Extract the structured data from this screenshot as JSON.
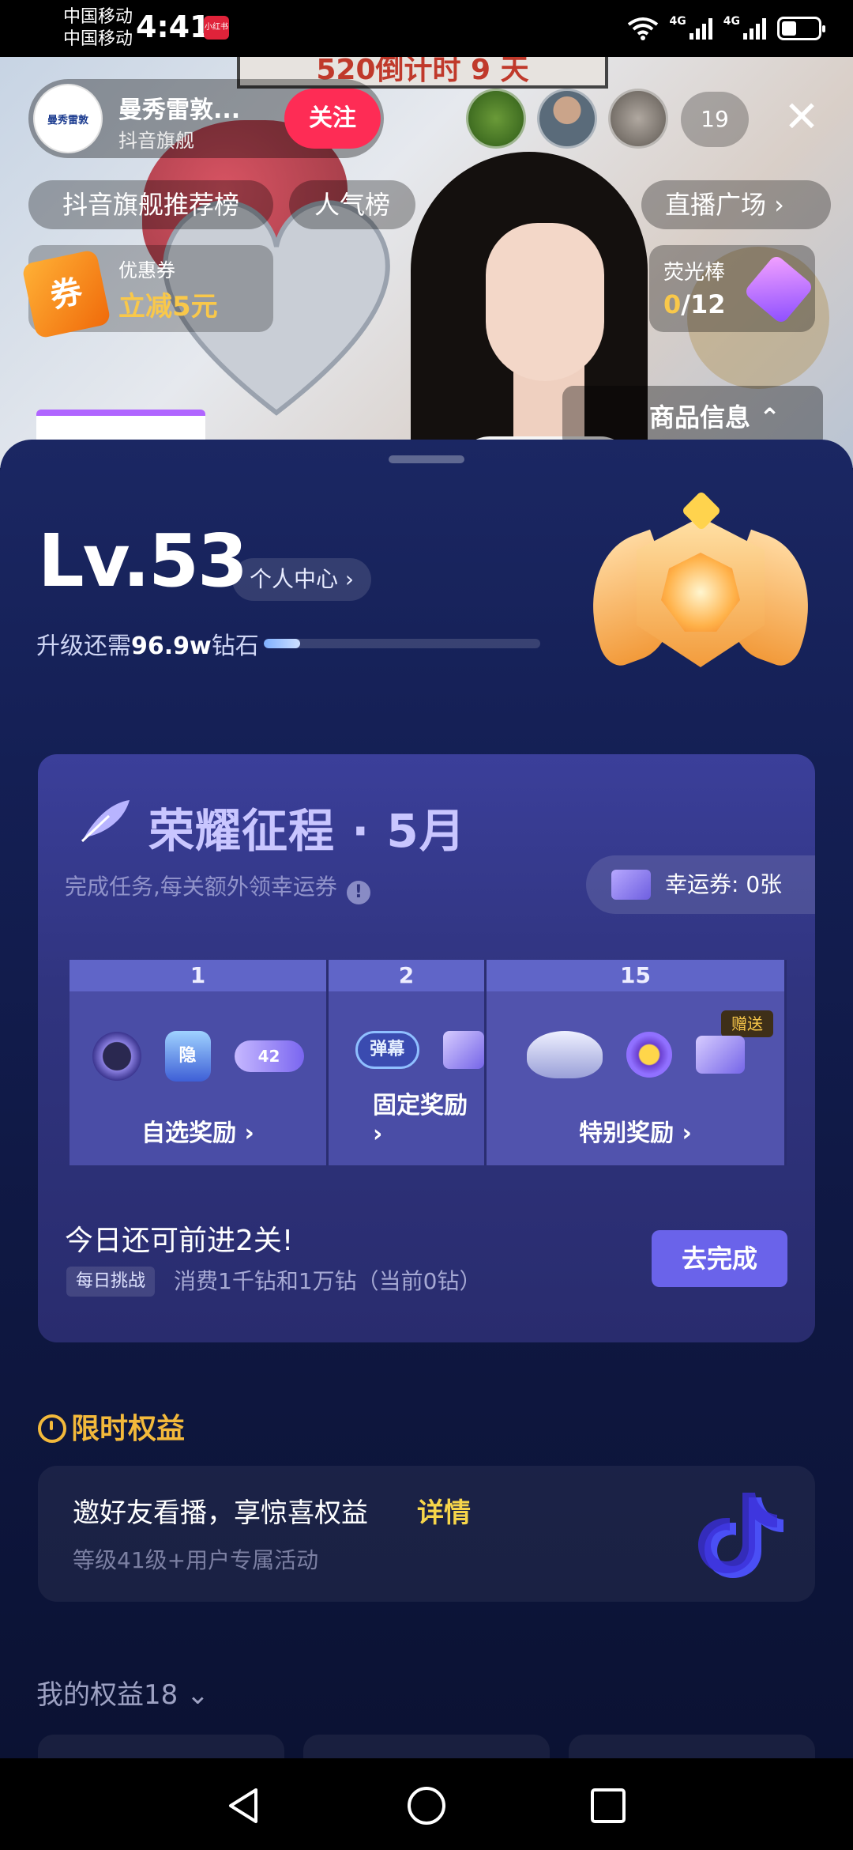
{
  "status_bar": {
    "carrier_1": "中国移动",
    "carrier_2": "中国移动",
    "time": "4:41",
    "app_badge": "小红书",
    "network_1": "4G",
    "network_2": "4G"
  },
  "live": {
    "banner_text": "520倒计时 9 天",
    "anchor_name": "曼秀雷敦...",
    "anchor_subtitle": "抖音旗舰",
    "anchor_avatar_text": "曼秀雷敦",
    "follow_label": "关注",
    "viewer_count": "19",
    "close_icon": "close-icon",
    "pills": {
      "recommend": "抖音旗舰推荐榜",
      "popularity": "人气榜",
      "plaza": "直播广场 ›"
    },
    "coupon": {
      "icon_text": "券",
      "label": "优惠券",
      "value": "立减5元"
    },
    "glowstick": {
      "label": "荧光棒",
      "current": "0",
      "total": "/12"
    },
    "product_info": "商品信息 ⌃"
  },
  "sheet": {
    "level": "Lv.53",
    "profile_link": "个人中心 ›",
    "upgrade_prefix": "升级还需",
    "upgrade_amount": "96.9w",
    "upgrade_suffix": "钻石",
    "progress_fraction": 0.13,
    "quest": {
      "title": "荣耀征程 · 5月",
      "subtitle": "完成任务,每关额外领幸运券",
      "info_icon": "!",
      "lucky_label": "幸运券:",
      "lucky_value": "0张",
      "stages": [
        {
          "num": "1",
          "label": "自选奖励 ›",
          "chip": "42"
        },
        {
          "num": "2",
          "label": "固定奖励 ›",
          "chip": "弹幕"
        },
        {
          "num": "15",
          "label": "特别奖励 ›",
          "gift_tag": "赠送"
        }
      ],
      "shield_text": "隐",
      "today_text": "今日还可前进2关!",
      "daily_tag": "每日挑战",
      "daily_desc": "消费1千钻和1万钻（当前0钻）",
      "go_button": "去完成"
    },
    "limited": {
      "title": "限时权益",
      "invite_title": "邀好友看播，享惊喜权益",
      "invite_detail": "详情",
      "invite_sub": "等级41级+用户专属活动"
    },
    "my_rights": "我的权益18",
    "my_rights_icon": "chevron-down-icon"
  },
  "nav": {
    "back_icon": "back-triangle-icon",
    "home_icon": "home-circle-icon",
    "recents_icon": "recents-square-icon"
  },
  "colors": {
    "accent_red": "#fe2c55",
    "gold": "#f9c84a",
    "sheet_bg": "#141f54",
    "button_purple": "#6a63ea"
  }
}
